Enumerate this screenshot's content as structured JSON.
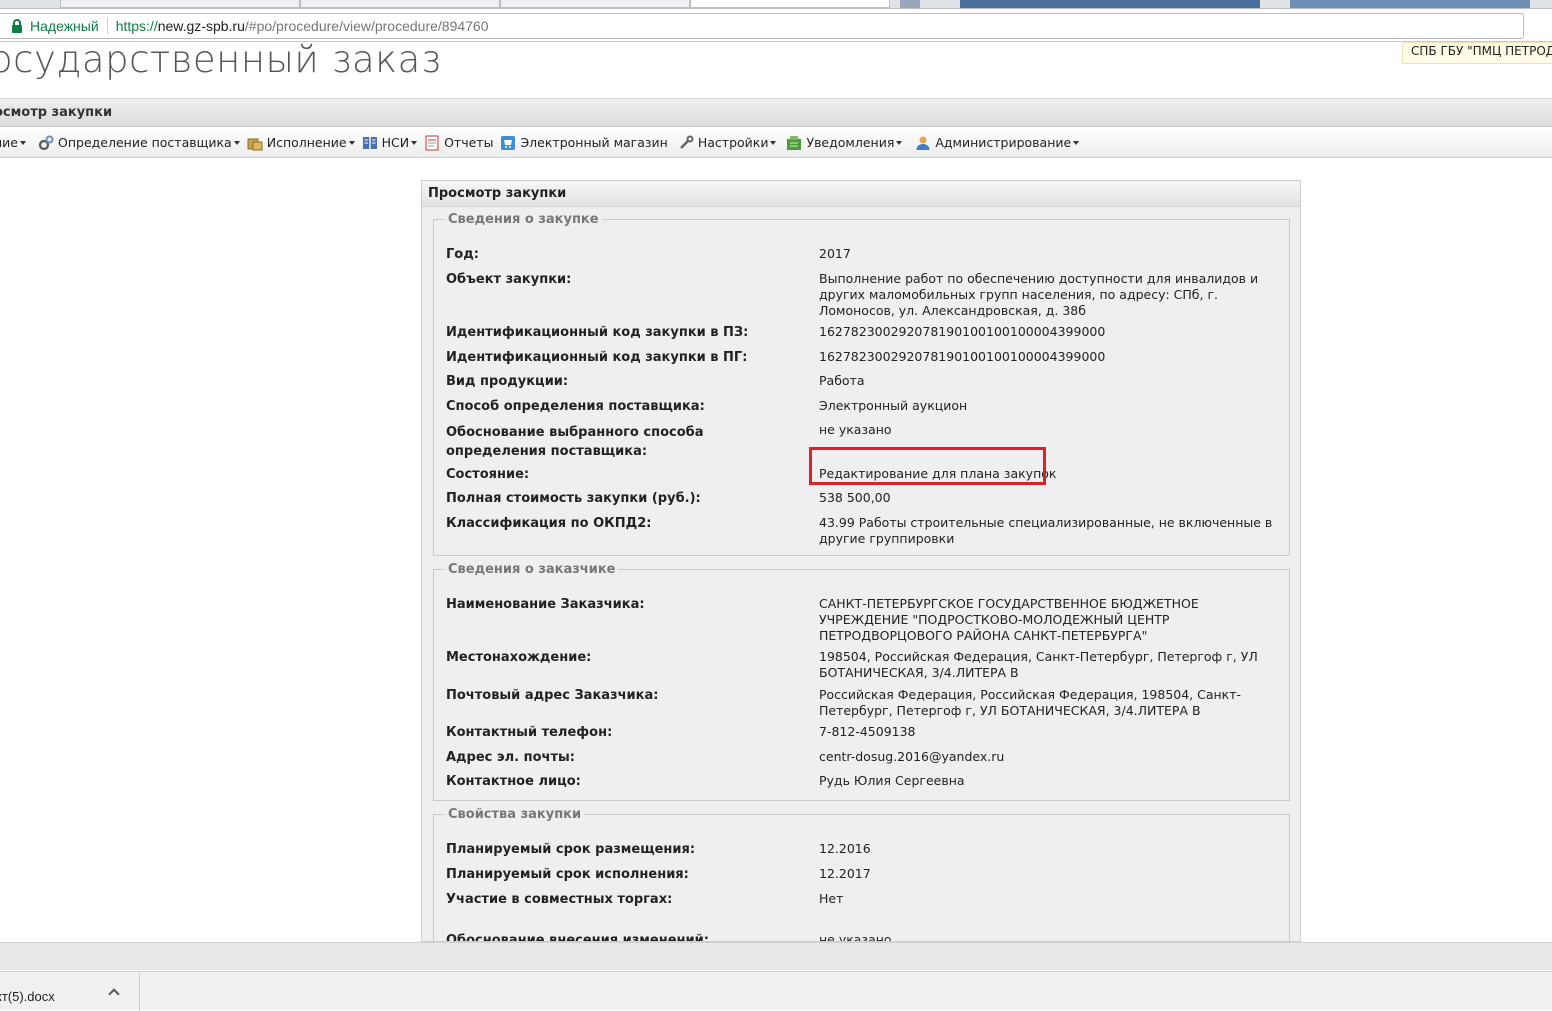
{
  "browser": {
    "secure_label": "Надежный",
    "url_scheme": "https://",
    "url_host": "new.gz-spb.ru",
    "url_path": "/#po/procedure/view/procedure/894760"
  },
  "site": {
    "title": "осударственный заказ",
    "org_badge": "СПБ ГБУ \"ПМЦ ПЕТРОДВО"
  },
  "crumb": "осмотр закупки",
  "nav": [
    {
      "label": "ние",
      "icon": "none",
      "dropdown": true
    },
    {
      "label": "Определение поставщика",
      "icon": "gears-icon",
      "dropdown": true
    },
    {
      "label": "Исполнение",
      "icon": "box-icon",
      "dropdown": true
    },
    {
      "label": "НСИ",
      "icon": "book-icon",
      "dropdown": true
    },
    {
      "label": "Отчеты",
      "icon": "report-icon",
      "dropdown": false
    },
    {
      "label": "Электронный магазин",
      "icon": "cart-icon",
      "dropdown": false
    },
    {
      "label": "Настройки",
      "icon": "wrench-icon",
      "dropdown": true
    },
    {
      "label": "Уведомления",
      "icon": "notification-icon",
      "dropdown": true
    },
    {
      "label": "Администрирование",
      "icon": "user-icon",
      "dropdown": true
    }
  ],
  "panel": {
    "title": "Просмотр закупки",
    "sections": [
      {
        "legend": "Сведения о закупке",
        "rows": [
          {
            "label": "Год:",
            "value": "2017"
          },
          {
            "label": "Объект закупки:",
            "value": "Выполнение работ по обеспечению доступности для инвалидов и других маломобильных групп населения, по адресу: СПб, г. Ломоносов, ул. Александровская, д. 38б"
          },
          {
            "label": "Идентификационный код закупки в ПЗ:",
            "value": "162782300292078190100100100004399000"
          },
          {
            "label": "Идентификационный код закупки в ПГ:",
            "value": "162782300292078190100100100004399000"
          },
          {
            "label": "Вид продукции:",
            "value": "Работа"
          },
          {
            "label": "Способ определения поставщика:",
            "value": "Электронный аукцион"
          },
          {
            "label": "Обоснование выбранного способа определения поставщика:",
            "value": "не указано"
          },
          {
            "label": "Состояние:",
            "value": "Редактирование для плана закупок"
          },
          {
            "label": "Полная стоимость закупки (руб.):",
            "value": "538 500,00"
          },
          {
            "label": "Классификация по ОКПД2:",
            "value": "43.99 Работы строительные специализированные, не включенные в другие группировки"
          }
        ]
      },
      {
        "legend": "Сведения о заказчике",
        "rows": [
          {
            "label": "Наименование Заказчика:",
            "value": "САНКТ-ПЕТЕРБУРГСКОЕ ГОСУДАРСТВЕННОЕ БЮДЖЕТНОЕ УЧРЕЖДЕНИЕ \"ПОДРОСТКОВО-МОЛОДЕЖНЫЙ ЦЕНТР ПЕТРОДВОРЦОВОГО РАЙОНА САНКТ-ПЕТЕРБУРГА\""
          },
          {
            "label": "Местонахождение:",
            "value": "198504, Российская Федерация, Санкт-Петербург, Петергоф г, УЛ БОТАНИЧЕСКАЯ, 3/4.ЛИТЕРА В"
          },
          {
            "label": "Почтовый адрес Заказчика:",
            "value": "Российская Федерация, Российская Федерация, 198504, Санкт-Петербург, Петергоф г, УЛ БОТАНИЧЕСКАЯ, 3/4.ЛИТЕРА В"
          },
          {
            "label": "Контактный телефон:",
            "value": "7-812-4509138"
          },
          {
            "label": "Адрес эл. почты:",
            "value": "centr-dosug.2016@yandex.ru"
          },
          {
            "label": "Контактное лицо:",
            "value": "Рудь Юлия Сергеевна"
          }
        ]
      },
      {
        "legend": "Свойства закупки",
        "rows": [
          {
            "label": "Планируемый срок размещения:",
            "value": "12.2016"
          },
          {
            "label": "Планируемый срок исполнения:",
            "value": "12.2017"
          },
          {
            "label": "Участие в совместных торгах:",
            "value": "Нет"
          },
          {
            "label": "Обоснование внесения изменений:",
            "value": "не указано"
          }
        ]
      }
    ]
  },
  "downloads": {
    "file_name": "кт(5).docx"
  },
  "colors": {
    "highlight_border": "#d8232a",
    "secure_green": "#0b8043"
  }
}
